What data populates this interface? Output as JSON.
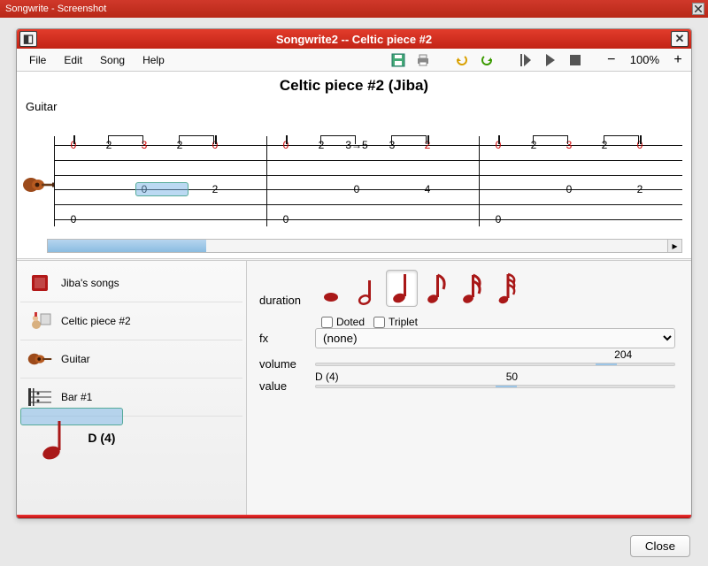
{
  "outer_window": {
    "title": "Songwrite - Screenshot"
  },
  "app_window": {
    "title": "Songwrite2 -- Celtic piece #2"
  },
  "menu": {
    "file": "File",
    "edit": "Edit",
    "song": "Song",
    "help": "Help"
  },
  "zoom": {
    "level": "100%"
  },
  "score": {
    "title": "Celtic piece #2 (Jiba)",
    "instrument": "Guitar"
  },
  "tree": {
    "songbook": "Jiba's songs",
    "song": "Celtic piece #2",
    "instrument": "Guitar",
    "bar": "Bar #1",
    "note": "D (4)"
  },
  "props": {
    "duration_label": "duration",
    "dotted_label": "Doted",
    "triplet_label": "Triplet",
    "fx_label": "fx",
    "fx_value": "(none)",
    "volume_label": "volume",
    "volume_value": "204",
    "value_label": "value",
    "value_text": "D (4)",
    "value_num": "50"
  },
  "close_button": "Close",
  "tab": {
    "strings": 6,
    "measures": [
      {
        "top": [
          "0",
          "2",
          "3",
          "2",
          "0"
        ],
        "mid": [
          "",
          "",
          "0",
          "",
          "2"
        ],
        "bot": "0",
        "top_red": [
          0,
          2,
          4
        ],
        "sel_from": 2,
        "sel_to": 3
      },
      {
        "top": [
          "0",
          "2",
          "3→5",
          "3",
          "2"
        ],
        "mid": [
          "",
          "",
          "0",
          "",
          "4"
        ],
        "bot": "0",
        "top_red": [
          0,
          4
        ]
      },
      {
        "top": [
          "0",
          "2",
          "3",
          "2",
          "0"
        ],
        "mid": [
          "",
          "",
          "0",
          "",
          "2"
        ],
        "bot": "0",
        "top_red": [
          0,
          2,
          4
        ],
        "truncated": true
      }
    ]
  }
}
